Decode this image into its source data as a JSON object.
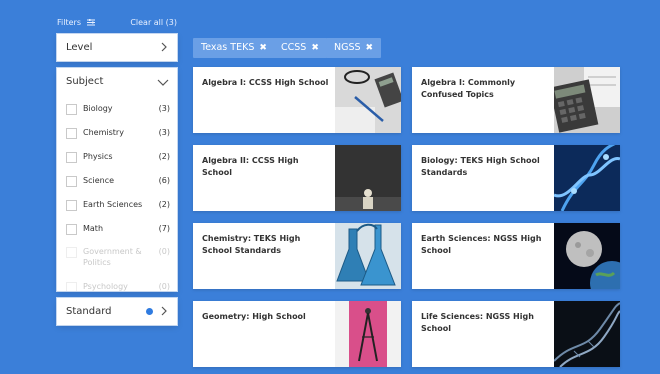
{
  "filters": {
    "title": "Filters",
    "clear_label": "Clear all (3)",
    "level": {
      "label": "Level"
    },
    "subject": {
      "label": "Subject",
      "items": [
        {
          "name": "Biology",
          "count": "(3)",
          "enabled": true
        },
        {
          "name": "Chemistry",
          "count": "(3)",
          "enabled": true
        },
        {
          "name": "Physics",
          "count": "(2)",
          "enabled": true
        },
        {
          "name": "Science",
          "count": "(6)",
          "enabled": true
        },
        {
          "name": "Earth Sciences",
          "count": "(2)",
          "enabled": true
        },
        {
          "name": "Math",
          "count": "(7)",
          "enabled": true
        },
        {
          "name": "Government & Politics",
          "count": "(0)",
          "enabled": false
        },
        {
          "name": "Psychology",
          "count": "(0)",
          "enabled": false
        }
      ]
    },
    "standard": {
      "label": "Standard"
    }
  },
  "chips": [
    {
      "label": "Texas TEKS",
      "remove": "✖"
    },
    {
      "label": "CCSS",
      "remove": "✖"
    },
    {
      "label": "NGSS",
      "remove": "✖"
    }
  ],
  "cards": [
    {
      "title": "Algebra I: CCSS High School",
      "thumb": "calculator-desk-icon"
    },
    {
      "title": "Algebra I: Commonly Confused Topics",
      "thumb": "calculator-icon"
    },
    {
      "title": "Algebra II: CCSS High School",
      "thumb": "chalkboard-icon"
    },
    {
      "title": "Biology: TEKS High School Standards",
      "thumb": "dna-icon"
    },
    {
      "title": "Chemistry: TEKS High School Standards",
      "thumb": "flask-icon"
    },
    {
      "title": "Earth Sciences: NGSS High School",
      "thumb": "earth-moon-icon"
    },
    {
      "title": "Geometry: High School",
      "thumb": "compass-icon"
    },
    {
      "title": "Life Sciences: NGSS High School",
      "thumb": "dna-helix-icon"
    }
  ],
  "colors": {
    "background": "#3b7fd9",
    "chip": "#6a9fe6",
    "accent_dot": "#2f7be0"
  }
}
